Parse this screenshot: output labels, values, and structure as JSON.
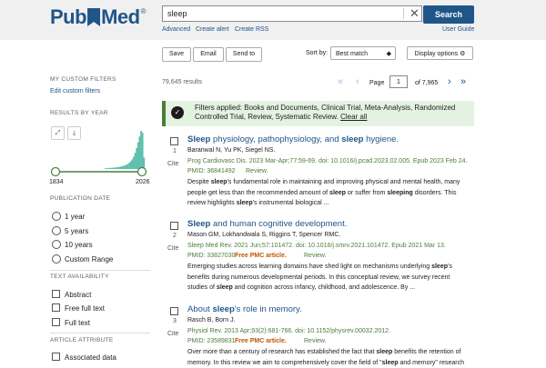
{
  "header": {
    "logo_text": "PubMed",
    "logo_reg": "®",
    "search_value": "sleep",
    "search_button": "Search",
    "advanced": "Advanced",
    "create_alert": "Create alert",
    "create_rss": "Create RSS",
    "user_guide": "User Guide"
  },
  "toolbar": {
    "save": "Save",
    "email": "Email",
    "send_to": "Send to",
    "sort_by_label": "Sort by:",
    "sort_value": "Best match",
    "display_options": "Display options"
  },
  "sidebar": {
    "custom_filters_head": "MY CUSTOM FILTERS",
    "edit_custom_filters": "Edit custom filters",
    "results_by_year_head": "RESULTS BY YEAR",
    "year_start": "1834",
    "year_end": "2026",
    "histogram": [
      0.02,
      0.02,
      0.02,
      0.03,
      0.03,
      0.03,
      0.04,
      0.04,
      0.05,
      0.05,
      0.06,
      0.07,
      0.08,
      0.09,
      0.11,
      0.13,
      0.16,
      0.2,
      0.25,
      0.32,
      0.42,
      0.55,
      0.7,
      0.85,
      1.0,
      0.95,
      0.3
    ],
    "publication_date_head": "PUBLICATION DATE",
    "date_options": [
      "1 year",
      "5 years",
      "10 years",
      "Custom Range"
    ],
    "text_availability_head": "TEXT AVAILABILITY",
    "text_options": [
      "Abstract",
      "Free full text",
      "Full text"
    ],
    "article_attribute_head": "ARTICLE ATTRIBUTE",
    "attribute_options": [
      "Associated data"
    ]
  },
  "results": {
    "count": "79,645 results",
    "page_label": "Page",
    "page_value": "1",
    "page_of": "of 7,965",
    "filters_applied": "Filters applied: Books and Documents, Clinical Trial, Meta-Analysis, Randomized Controlled Trial, Review, Systematic Review.",
    "clear_all": "Clear all",
    "cite_label": "Cite",
    "items": [
      {
        "number": "1",
        "title_html": "<b>Sleep</b> physiology, pathophysiology, and <b>sleep</b> hygiene.",
        "authors": "Baranwal N, Yu PK, Siegel NS.",
        "journal": "Prog Cardiovasc Dis. 2023 Mar-Apr;77:59-69. doi: 10.1016/j.pcad.2023.02.005. Epub 2023 Feb 24.",
        "pmid": "PMID: 36841492",
        "free": "",
        "type": "Review.",
        "snippet_html": "Despite <b>sleep</b>'s fundamental role in maintaining and improving physical and mental health, many people get less than the recommended amount of <b>sleep</b> or suffer from <b>sleeping</b> disorders. This review highlights <b>sleep</b>'s instrumental biological ..."
      },
      {
        "number": "2",
        "title_html": "<b>Sleep</b> and human cognitive development.",
        "authors": "Mason GM, Lokhandwala S, Riggins T, Spencer RMC.",
        "journal": "Sleep Med Rev. 2021 Jun;57:101472. doi: 10.1016/j.smrv.2021.101472. Epub 2021 Mar 13.",
        "pmid": "PMID: 33827030",
        "free": "Free PMC article.",
        "type": "Review.",
        "snippet_html": "Emerging studies across learning domains have shed light on mechanisms underlying <b>sleep</b>'s benefits during numerous developmental periods. In this conceptual review, we survey recent studies of <b>sleep</b> and cognition across infancy, childhood, and adolescence. By ..."
      },
      {
        "number": "3",
        "title_html": "About <b>sleep</b>'s role in memory.",
        "authors": "Rasch B, Born J.",
        "journal": "Physiol Rev. 2013 Apr;93(2):681-766. doi: 10.1152/physrev.00032.2012.",
        "pmid": "PMID: 23589831",
        "free": "Free PMC article.",
        "type": "Review.",
        "snippet_html": "Over more than a century of research has established the fact that <b>sleep</b> benefits the retention of memory. In this review we aim to comprehensively cover the field of \"<b>sleep</b> and memory\" research"
      }
    ]
  },
  "colors": {
    "brand": "#20558a",
    "accent_green": "#4b7d3a",
    "histogram": "#5fbfae",
    "free_article": "#c05600"
  },
  "icons": [
    "close-icon",
    "gear-icon",
    "checkmark-icon",
    "expand-icon",
    "download-icon",
    "first-page-icon",
    "prev-page-icon",
    "next-page-icon",
    "last-page-icon"
  ]
}
